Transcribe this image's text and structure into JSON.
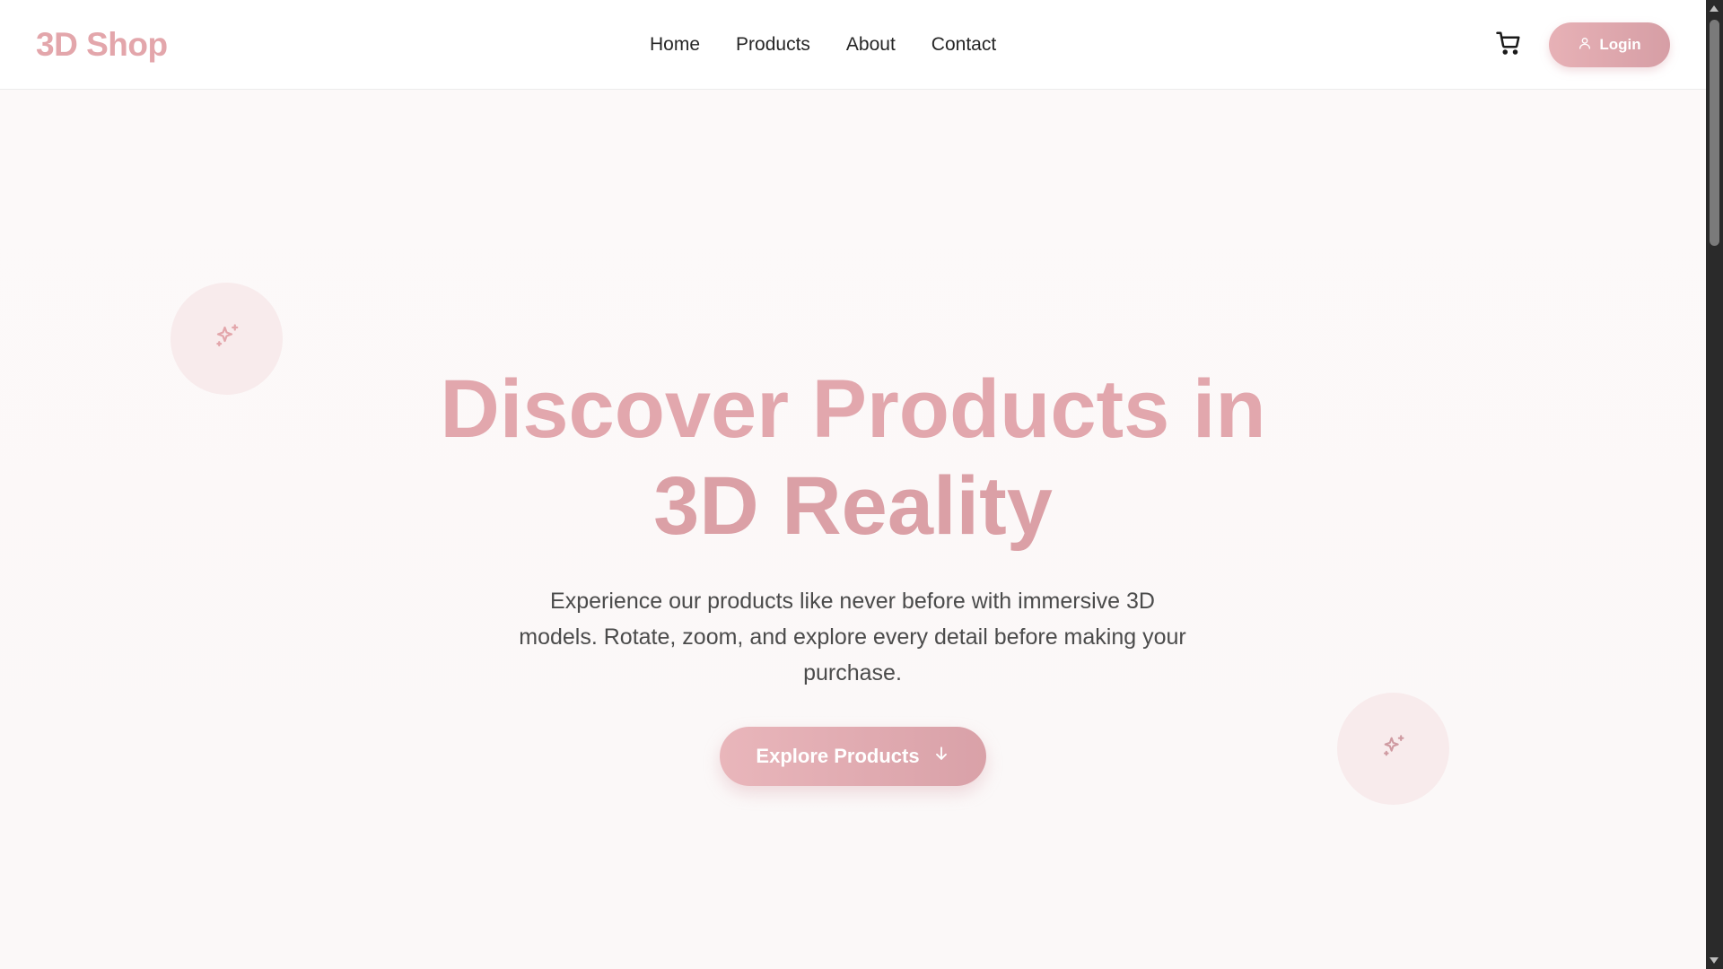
{
  "header": {
    "logo": "3D Shop",
    "nav": [
      {
        "label": "Home"
      },
      {
        "label": "Products"
      },
      {
        "label": "About"
      },
      {
        "label": "Contact"
      }
    ],
    "cart_icon": "shopping-cart-icon",
    "login_label": "Login",
    "login_icon": "user-icon"
  },
  "hero": {
    "title_line1": "Discover Products in",
    "title_line2": "3D Reality",
    "subtitle": "Experience our products like never before with immersive 3D models. Rotate, zoom, and explore every detail before making your purchase.",
    "cta_label": "Explore Products",
    "cta_icon": "arrow-down-icon",
    "decor_icon": "sparkles-icon"
  },
  "colors": {
    "accent": "#e2a7ad",
    "accent_dark": "#d69ea5",
    "text": "#262626",
    "background": "#fcf9f9"
  }
}
